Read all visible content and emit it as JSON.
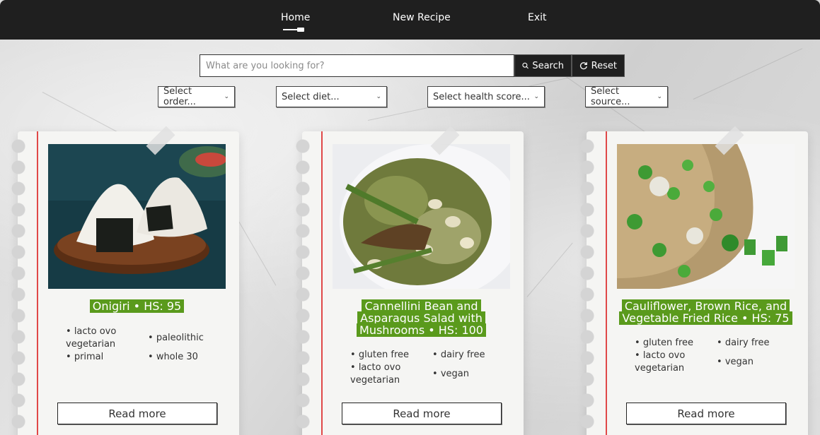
{
  "nav": {
    "home": "Home",
    "new_recipe": "New Recipe",
    "exit": "Exit"
  },
  "search": {
    "placeholder": "What are you looking for?",
    "value": "",
    "search_label": "Search",
    "reset_label": "Reset"
  },
  "filters": {
    "order": "Select order...",
    "diet": "Select diet...",
    "health": "Select health score...",
    "source": "Select source..."
  },
  "colors": {
    "navbar": "#1f1f1f",
    "title_highlight": "#5a9a1c",
    "margin_line": "#e04848"
  },
  "recipes": [
    {
      "title": "Onigiri • HS: 95",
      "diets": [
        "lacto ovo vegetarian",
        "paleolithic",
        "primal",
        "whole 30"
      ],
      "read_more": "Read more"
    },
    {
      "title": "Cannellini Bean and Asparagus Salad with Mushrooms • HS: 100",
      "diets": [
        "gluten free",
        "dairy free",
        "lacto ovo vegetarian",
        "vegan"
      ],
      "read_more": "Read more"
    },
    {
      "title": "Cauliflower, Brown Rice, and Vegetable Fried Rice • HS: 75",
      "diets": [
        "gluten free",
        "dairy free",
        "lacto ovo vegetarian",
        "vegan"
      ],
      "read_more": "Read more"
    }
  ]
}
